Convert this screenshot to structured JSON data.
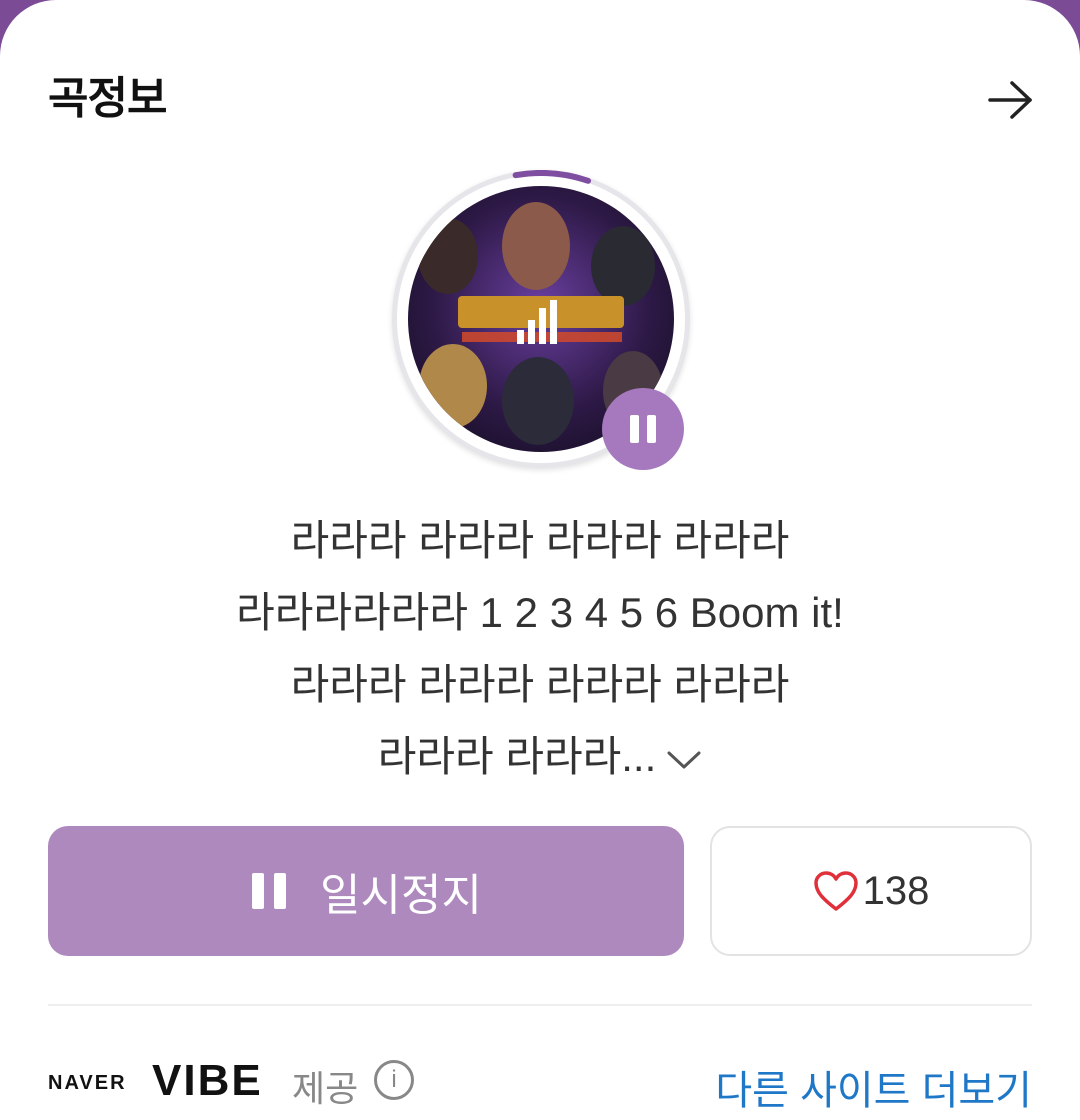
{
  "header": {
    "title": "곡정보"
  },
  "icons": {
    "forward": "arrow-right-icon",
    "pause": "pause-icon",
    "expand": "chevron-down-icon",
    "heart": "heart-outline-icon",
    "info": "info-icon",
    "playing": "equalizer-icon"
  },
  "player": {
    "progress_percent": 8
  },
  "lyrics": {
    "lines": [
      "라라라 라라라 라라라 라라라",
      "라라라라라라 1 2 3 4 5 6 Boom it!",
      "라라라 라라라 라라라 라라라",
      "라라라 라라라..."
    ]
  },
  "actions": {
    "pause_label": "일시정지",
    "like_count": "138"
  },
  "footer": {
    "naver": "NAVER",
    "vibe": "VIBE",
    "provided": "제공",
    "info": "i",
    "other_sites": "다른 사이트 더보기"
  },
  "colors": {
    "accent": "#ae89bd",
    "accent_dark": "#a679bf",
    "background": "#7b4b96",
    "heart": "#e0303a",
    "link": "#1f77c7"
  }
}
